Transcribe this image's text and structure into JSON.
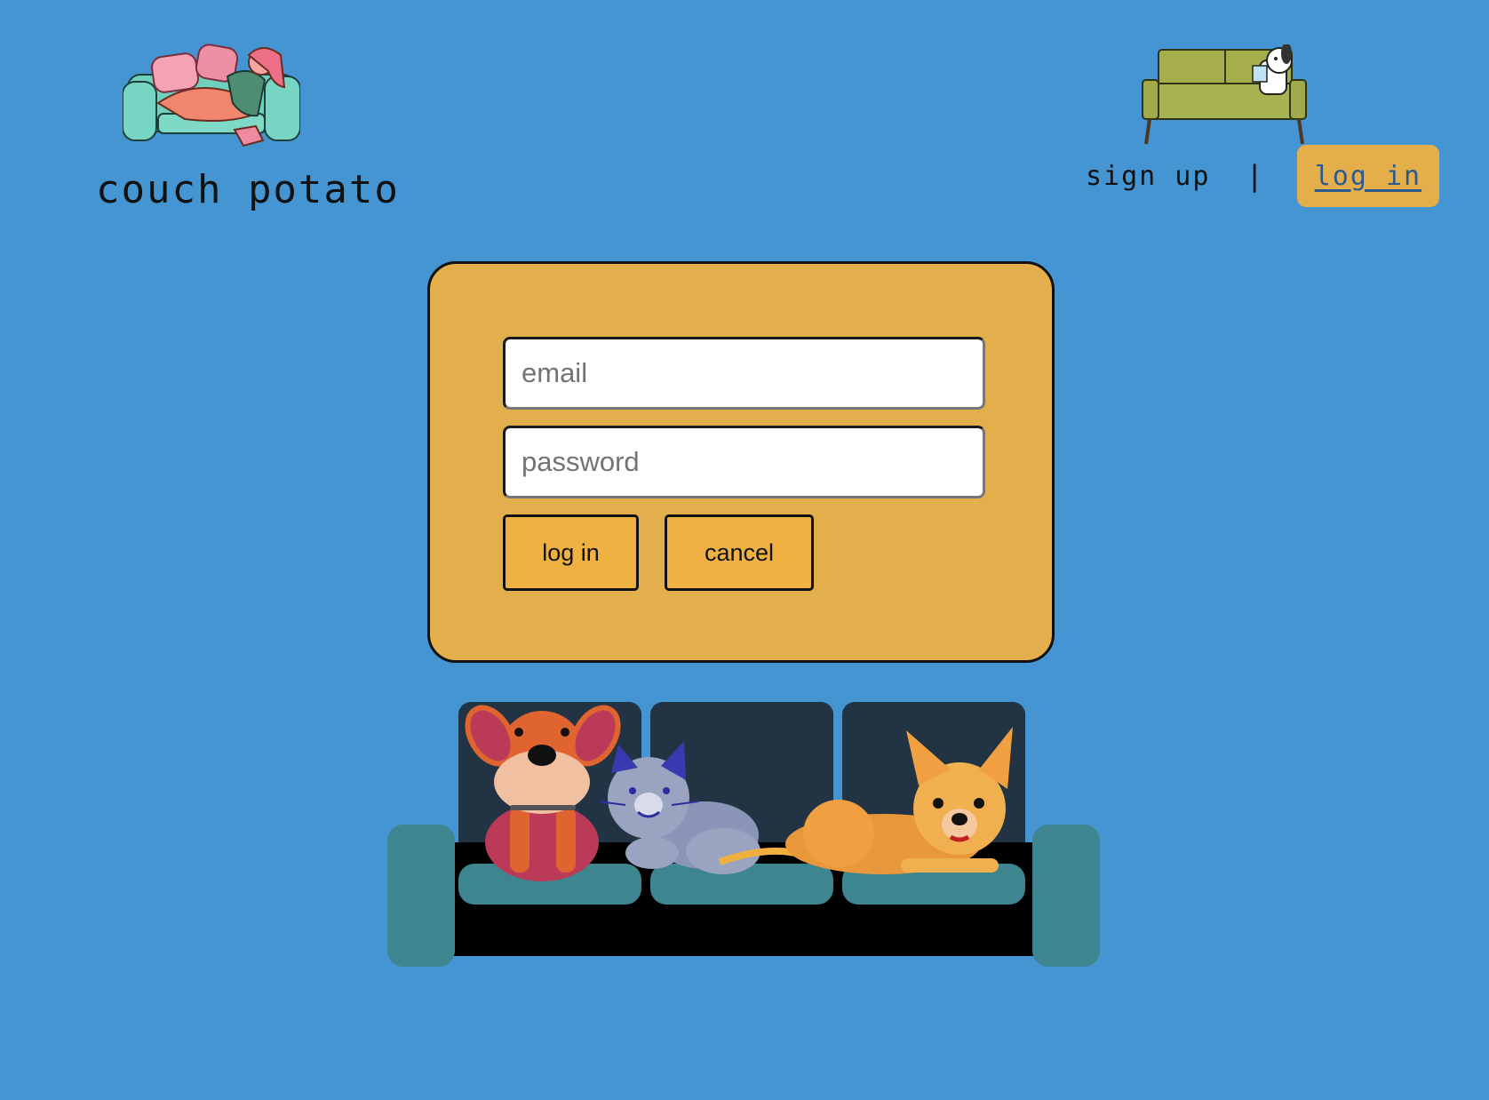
{
  "header": {
    "brand": "couch potato",
    "logo_icon": "person-on-couch-icon",
    "nav_icon": "dog-on-couch-icon"
  },
  "nav": {
    "signup_label": "sign up",
    "separator": "|",
    "login_label": "log in"
  },
  "login_form": {
    "email_placeholder": "email",
    "email_value": "",
    "password_placeholder": "password",
    "password_value": "",
    "submit_label": "log in",
    "cancel_label": "cancel"
  },
  "illustration": {
    "icon": "pets-on-couch-icon"
  },
  "colors": {
    "background": "#4495d1",
    "card": "#e3af4c",
    "button": "#f0b143",
    "nav_active": "#e4af4b"
  }
}
